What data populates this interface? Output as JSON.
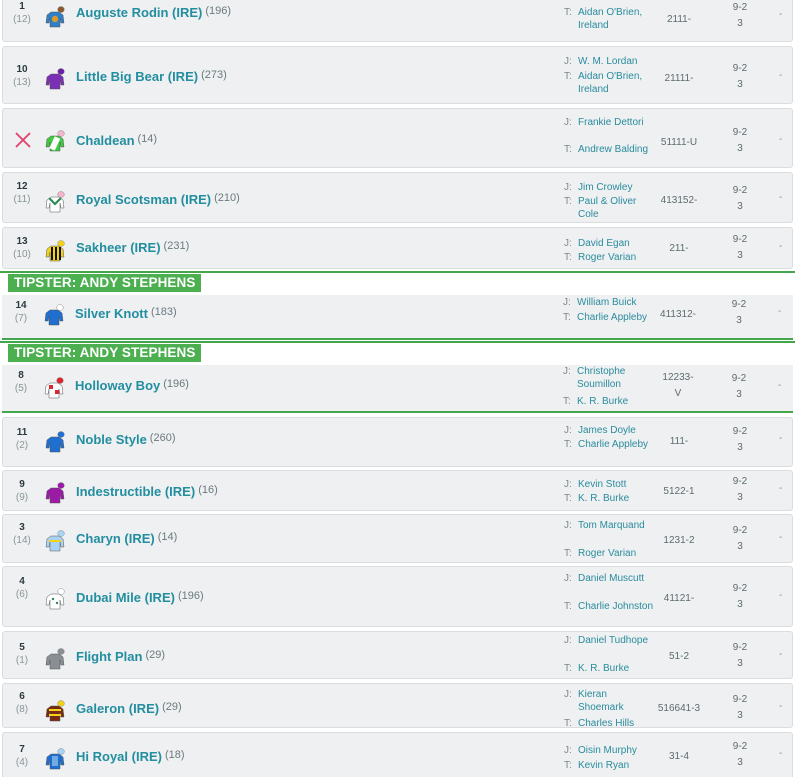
{
  "runners": [
    {
      "no": "1",
      "draw": "(12)",
      "name": "Auguste Rodin (IRE)",
      "rating": "(196)",
      "trainer_label": "T:",
      "trainer": "Aidan O'Brien, Ireland",
      "form": "2111-",
      "odds_top": "9-2",
      "odds_bottom": "3",
      "dash": "-",
      "silk_colors": [
        "#2f7fc8",
        "#d79a2b",
        "#8a5a2b"
      ]
    },
    {
      "no": "10",
      "draw": "(13)",
      "name": "Little Big Bear (IRE)",
      "rating": "(273)",
      "jockey_label": "J:",
      "jockey": "W. M. Lordan",
      "trainer_label": "T:",
      "trainer": "Aidan O'Brien, Ireland",
      "form": "21111-",
      "odds_top": "9-2",
      "odds_bottom": "3",
      "dash": "-",
      "silk_colors": [
        "#7b2fb5",
        "#7b2fb5",
        "#6a20a8"
      ]
    },
    {
      "no": "",
      "draw": "",
      "nonrunner": true,
      "name": "Chaldean",
      "rating": "(14)",
      "jockey_label": "J:",
      "jockey": "Frankie Dettori",
      "trainer_label": "T:",
      "trainer": "Andrew Balding",
      "form": "51111-U",
      "odds_top": "9-2",
      "odds_bottom": "3",
      "dash": "-",
      "silk_colors": [
        "#3ec93e",
        "#ffffff",
        "#f2b6c8"
      ]
    },
    {
      "no": "12",
      "draw": "(11)",
      "name": "Royal Scotsman (IRE)",
      "rating": "(210)",
      "jockey_label": "J:",
      "jockey": "Jim Crowley",
      "trainer_label": "T:",
      "trainer": "Paul & Oliver Cole",
      "form": "413152-",
      "odds_top": "9-2",
      "odds_bottom": "3",
      "dash": "-",
      "silk_colors": [
        "#ffffff",
        "#2e8b57",
        "#f2b6c8"
      ]
    },
    {
      "no": "13",
      "draw": "(10)",
      "name": "Sakheer (IRE)",
      "rating": "(231)",
      "jockey_label": "J:",
      "jockey": "David Egan",
      "trainer_label": "T:",
      "trainer": "Roger Varian",
      "form": "211-",
      "odds_top": "9-2",
      "odds_bottom": "3",
      "dash": "-",
      "silk_colors": [
        "#f2d21b",
        "#111111",
        "#f2d21b"
      ]
    },
    {
      "tipster": "TIPSTER: ANDY STEPHENS",
      "no": "14",
      "draw": "(7)",
      "name": "Silver Knott",
      "rating": "(183)",
      "jockey_label": "J:",
      "jockey": "William Buick",
      "trainer_label": "T:",
      "trainer": "Charlie Appleby",
      "form": "411312-",
      "odds_top": "9-2",
      "odds_bottom": "3",
      "dash": "-",
      "silk_colors": [
        "#1f6fd0",
        "#1f6fd0",
        "#ffffff"
      ]
    },
    {
      "tipster": "TIPSTER: ANDY STEPHENS",
      "no": "8",
      "draw": "(5)",
      "name": "Holloway Boy",
      "rating": "(196)",
      "jockey_label": "J:",
      "jockey": "Christophe Soumillon",
      "trainer_label": "T:",
      "trainer": "K. R. Burke",
      "form_top": "12233-",
      "form_bottom": "V",
      "odds_top": "9-2",
      "odds_bottom": "3",
      "dash": "-",
      "silk_colors": [
        "#ffffff",
        "#e0242c",
        "#e0242c"
      ]
    },
    {
      "no": "11",
      "draw": "(2)",
      "name": "Noble Style",
      "rating": "(260)",
      "jockey_label": "J:",
      "jockey": "James Doyle",
      "trainer_label": "T:",
      "trainer": "Charlie Appleby",
      "form": "111-",
      "odds_top": "9-2",
      "odds_bottom": "3",
      "dash": "-",
      "silk_colors": [
        "#1f6fd0",
        "#1f6fd0",
        "#1f6fd0"
      ]
    },
    {
      "no": "9",
      "draw": "(9)",
      "name": "Indestructible (IRE)",
      "rating": "(16)",
      "jockey_label": "J:",
      "jockey": "Kevin Stott",
      "trainer_label": "T:",
      "trainer": "K. R. Burke",
      "form": "5122-1",
      "odds_top": "9-2",
      "odds_bottom": "3",
      "dash": "-",
      "silk_colors": [
        "#9b1aa6",
        "#9b1aa6",
        "#9b1aa6"
      ]
    },
    {
      "no": "3",
      "draw": "(14)",
      "name": "Charyn (IRE)",
      "rating": "(14)",
      "jockey_label": "J:",
      "jockey": "Tom Marquand",
      "trainer_label": "T:",
      "trainer": "Roger Varian",
      "form": "1231-2",
      "odds_top": "9-2",
      "odds_bottom": "3",
      "dash": "-",
      "silk_colors": [
        "#a9d3f2",
        "#f2d21b",
        "#a9d3f2"
      ]
    },
    {
      "no": "4",
      "draw": "(6)",
      "name": "Dubai Mile (IRE)",
      "rating": "(196)",
      "jockey_label": "J:",
      "jockey": "Daniel Muscutt",
      "trainer_label": "T:",
      "trainer": "Charlie Johnston",
      "form": "41121-",
      "odds_top": "9-2",
      "odds_bottom": "3",
      "dash": "-",
      "silk_colors": [
        "#ffffff",
        "#2e8b57",
        "#ffffff"
      ]
    },
    {
      "no": "5",
      "draw": "(1)",
      "name": "Flight Plan",
      "rating": "(29)",
      "jockey_label": "J:",
      "jockey": "Daniel Tudhope",
      "trainer_label": "T:",
      "trainer": "K. R. Burke",
      "form": "51-2",
      "odds_top": "9-2",
      "odds_bottom": "3",
      "dash": "-",
      "silk_colors": [
        "#8a8f94",
        "#8a8f94",
        "#8a8f94"
      ]
    },
    {
      "no": "6",
      "draw": "(8)",
      "name": "Galeron (IRE)",
      "rating": "(29)",
      "jockey_label": "J:",
      "jockey": "Kieran Shoemark",
      "trainer_label": "T:",
      "trainer": "Charles Hills",
      "form": "516641-3",
      "odds_top": "9-2",
      "odds_bottom": "3",
      "dash": "-",
      "silk_colors": [
        "#7a2a10",
        "#f2d21b",
        "#f2d21b"
      ]
    },
    {
      "no": "7",
      "draw": "(4)",
      "name": "Hi Royal (IRE)",
      "rating": "(18)",
      "jockey_label": "J:",
      "jockey": "Oisin Murphy",
      "trainer_label": "T:",
      "trainer": "Kevin Ryan",
      "form": "31-4",
      "odds_top": "9-2",
      "odds_bottom": "3",
      "dash": "-",
      "silk_colors": [
        "#1f6fd0",
        "#1f6fd0",
        "#a9d3f2"
      ]
    }
  ]
}
